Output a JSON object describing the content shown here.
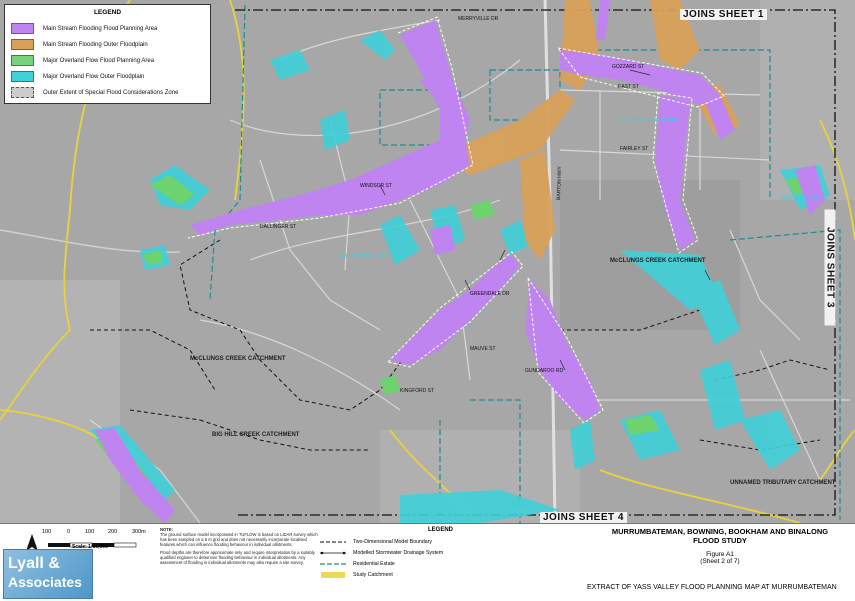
{
  "legend": {
    "title": "LEGEND",
    "items": [
      {
        "label": "Main Stream Flooding Flood Planning Area",
        "color": "#bf84f0"
      },
      {
        "label": "Main Stream Flooding Outer Floodplain",
        "color": "#d9a05a"
      },
      {
        "label": "Major Overland Flow Flood Planning Area",
        "color": "#78d27a"
      },
      {
        "label": "Major Overland Flow Outer Floodplain",
        "color": "#3fd0d8"
      },
      {
        "label": "Outer Extent of Special Flood Considerations Zone",
        "color": "#cccccc"
      }
    ]
  },
  "map": {
    "joins_top": "JOINS SHEET 1",
    "joins_bottom": "JOINS SHEET 4",
    "joins_right": "JOINS SHEET 3",
    "labels": {
      "merryville_estate": "MERRYVILLE ESTATE",
      "mcclungs_creek_catchment_east": "McCLUNGS CREEK CATCHMENT",
      "mcclungs_creek_catchment_west": "McCLUNGS CREEK CATCHMENT",
      "big_hill_creek_catchment": "BIG HILL CREEK CATCHMENT",
      "unnamed_tributary_catchment": "UNNAMED TRIBUTARY CATCHMENT",
      "carrington_park": "CARRINGTON PARK",
      "vineyard_ridge": "VINEYARD RIDGE"
    },
    "streets": {
      "barton_hwy": "BARTON HWY",
      "merryville": "MERRYVILLE DR",
      "gozzard": "GOZZARD ST",
      "east_st": "EAST ST",
      "fairley": "FAIRLEY ST",
      "windsor": "WINDSOR ST",
      "dallinger": "DALLINGER ST",
      "gundaroo": "GUNDAROO RD",
      "greendale": "GREENDALE DR",
      "mauve": "MAUVE ST",
      "kingford": "KINGFORD ST"
    }
  },
  "scalebar": {
    "ticks": [
      "100",
      "0",
      "100",
      "200",
      "300m"
    ],
    "scale": "Scale: 1:10,000"
  },
  "note": {
    "heading": "NOTE:",
    "p1": "The ground surface model incorporated in TUFLOW is based on LiDAR survey which has been sampled on a 5 m grid and does not necessarily incorporate localised features which can influence flooding behaviour in individual allotments.",
    "p2": "Flood depths are therefore approximate only and require interpretation by a suitably qualified engineer to determine flooding behaviour in individual allotments. Any assessment of flooding in individual allotments may also require a site survey."
  },
  "legend2": {
    "title": "LEGEND",
    "items": [
      {
        "label": "Two-Dimensional Model Boundary"
      },
      {
        "label": "Modelled Stormwater Drainage System"
      },
      {
        "label": "Residential Estate"
      },
      {
        "label": "Study Catchment"
      }
    ]
  },
  "logo": {
    "line1": "Lyall &",
    "line2": "Associates"
  },
  "title": {
    "line1": "MURRUMBATEMAN, BOWNING, BOOKHAM AND BINALONG",
    "line2": "FLOOD STUDY",
    "figure": "Figure A1",
    "sheet": "(Sheet 2 of 7)",
    "extract": "EXTRACT OF YASS VALLEY FLOOD PLANNING MAP AT MURRUMBATEMAN"
  }
}
